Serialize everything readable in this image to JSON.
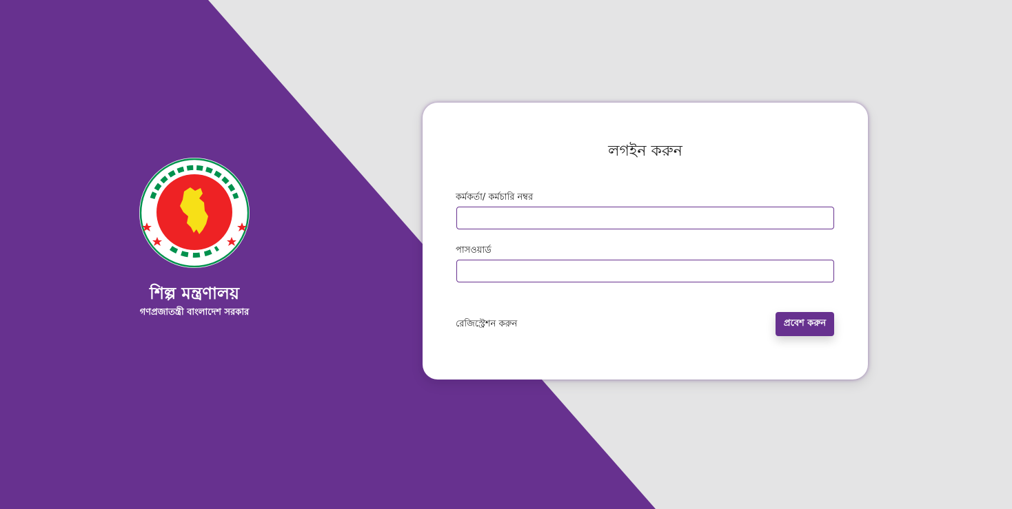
{
  "colors": {
    "primary_purple": "#67318f",
    "background_gray": "#e4e4e5",
    "card_bg": "#ffffff",
    "emblem_red": "#ee2224",
    "emblem_yellow": "#f7e017",
    "emblem_green": "#00914d"
  },
  "brand": {
    "emblem_icon": "bangladesh-government-emblem",
    "ministry_name": "শিল্প মন্ত্রণালয়",
    "government_name": "গণপ্রজাতন্ত্রী বাংলাদেশ সরকার"
  },
  "login": {
    "title": "লগইন করুন",
    "employee_id_label": "কর্মকর্তা/ কর্মচারি নম্বর",
    "employee_id_value": "",
    "password_label": "পাসওয়ার্ড",
    "password_value": "",
    "register_link": "রেজিস্ট্রেশন করুন",
    "submit_label": "প্রবেশ করুন"
  }
}
